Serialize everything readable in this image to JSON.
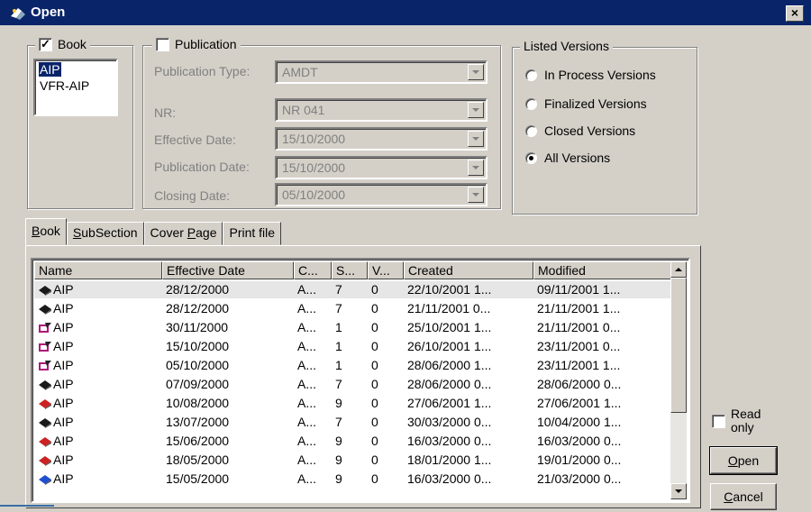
{
  "window": {
    "title": "Open",
    "close_glyph": "×"
  },
  "book_group": {
    "label": "Book",
    "checked": true,
    "items": [
      {
        "label": "AIP",
        "selected": true
      },
      {
        "label": "VFR-AIP",
        "selected": false
      }
    ]
  },
  "publication_group": {
    "label": "Publication",
    "checked": false,
    "fields": [
      {
        "label": "Publication Type:",
        "value": "AMDT"
      },
      {
        "label": "NR:",
        "value": "NR 041"
      },
      {
        "label": "Effective Date:",
        "value": "15/10/2000"
      },
      {
        "label": "Publication Date:",
        "value": "15/10/2000"
      },
      {
        "label": "Closing Date:",
        "value": "05/10/2000"
      }
    ]
  },
  "versions_group": {
    "label": "Listed Versions",
    "options": [
      {
        "label": "In Process Versions",
        "checked": false
      },
      {
        "label": "Finalized Versions",
        "checked": false
      },
      {
        "label": "Closed Versions",
        "checked": false
      },
      {
        "label": "All Versions",
        "checked": true
      }
    ]
  },
  "tabs": [
    {
      "prefix": "",
      "key": "B",
      "rest": "ook",
      "active": true
    },
    {
      "prefix": "",
      "key": "S",
      "rest": "ubSection",
      "active": false
    },
    {
      "prefix": "Cover ",
      "key": "P",
      "rest": "age",
      "active": false
    },
    {
      "prefix": "Print file",
      "key": "",
      "rest": "",
      "active": false
    }
  ],
  "table": {
    "columns": [
      "Name",
      "Effective Date",
      "C...",
      "S...",
      "V...",
      "Created",
      "Modified"
    ],
    "rows": [
      {
        "icon": "black-book-icon",
        "name": "AIP",
        "effective": "28/12/2000",
        "c": "A...",
        "s": "7",
        "v": "0",
        "created": "22/10/2001 1...",
        "modified": "09/11/2001 1..."
      },
      {
        "icon": "black-book-icon",
        "name": "AIP",
        "effective": "28/12/2000",
        "c": "A...",
        "s": "7",
        "v": "0",
        "created": "21/11/2001 0...",
        "modified": "21/11/2001 1..."
      },
      {
        "icon": "edit-book-icon",
        "name": "AIP",
        "effective": "30/11/2000",
        "c": "A...",
        "s": "1",
        "v": "0",
        "created": "25/10/2001 1...",
        "modified": "21/11/2001 0..."
      },
      {
        "icon": "edit-book-icon",
        "name": "AIP",
        "effective": "15/10/2000",
        "c": "A...",
        "s": "1",
        "v": "0",
        "created": "26/10/2001 1...",
        "modified": "23/11/2001 0..."
      },
      {
        "icon": "edit-book-icon",
        "name": "AIP",
        "effective": "05/10/2000",
        "c": "A...",
        "s": "1",
        "v": "0",
        "created": "28/06/2000 1...",
        "modified": "23/11/2001 1..."
      },
      {
        "icon": "black-book-icon",
        "name": "AIP",
        "effective": "07/09/2000",
        "c": "A...",
        "s": "7",
        "v": "0",
        "created": "28/06/2000 0...",
        "modified": "28/06/2000 0..."
      },
      {
        "icon": "red-book-icon",
        "name": "AIP",
        "effective": "10/08/2000",
        "c": "A...",
        "s": "9",
        "v": "0",
        "created": "27/06/2001 1...",
        "modified": "27/06/2001 1..."
      },
      {
        "icon": "black-book-icon",
        "name": "AIP",
        "effective": "13/07/2000",
        "c": "A...",
        "s": "7",
        "v": "0",
        "created": "30/03/2000 0...",
        "modified": "10/04/2000 1..."
      },
      {
        "icon": "red-book-icon",
        "name": "AIP",
        "effective": "15/06/2000",
        "c": "A...",
        "s": "9",
        "v": "0",
        "created": "16/03/2000 0...",
        "modified": "16/03/2000 0..."
      },
      {
        "icon": "red-book-icon",
        "name": "AIP",
        "effective": "18/05/2000",
        "c": "A...",
        "s": "9",
        "v": "0",
        "created": "18/01/2000 1...",
        "modified": "19/01/2000 0..."
      },
      {
        "icon": "blue-book-icon",
        "name": "AIP",
        "effective": "15/05/2000",
        "c": "A...",
        "s": "9",
        "v": "0",
        "created": "16/03/2000 0...",
        "modified": "21/03/2000 0..."
      }
    ]
  },
  "read_only": {
    "label": "Read only",
    "checked": false
  },
  "buttons": {
    "open": {
      "key": "O",
      "rest": "pen"
    },
    "cancel": {
      "key": "C",
      "rest": "ancel"
    }
  },
  "colors": {
    "titlebar": "#0a246a",
    "face": "#d4d0c8",
    "black_book": "#1a1a1a",
    "red_book": "#cc2222",
    "blue_book": "#1f4fd0",
    "edit_book": "#b0157a"
  }
}
